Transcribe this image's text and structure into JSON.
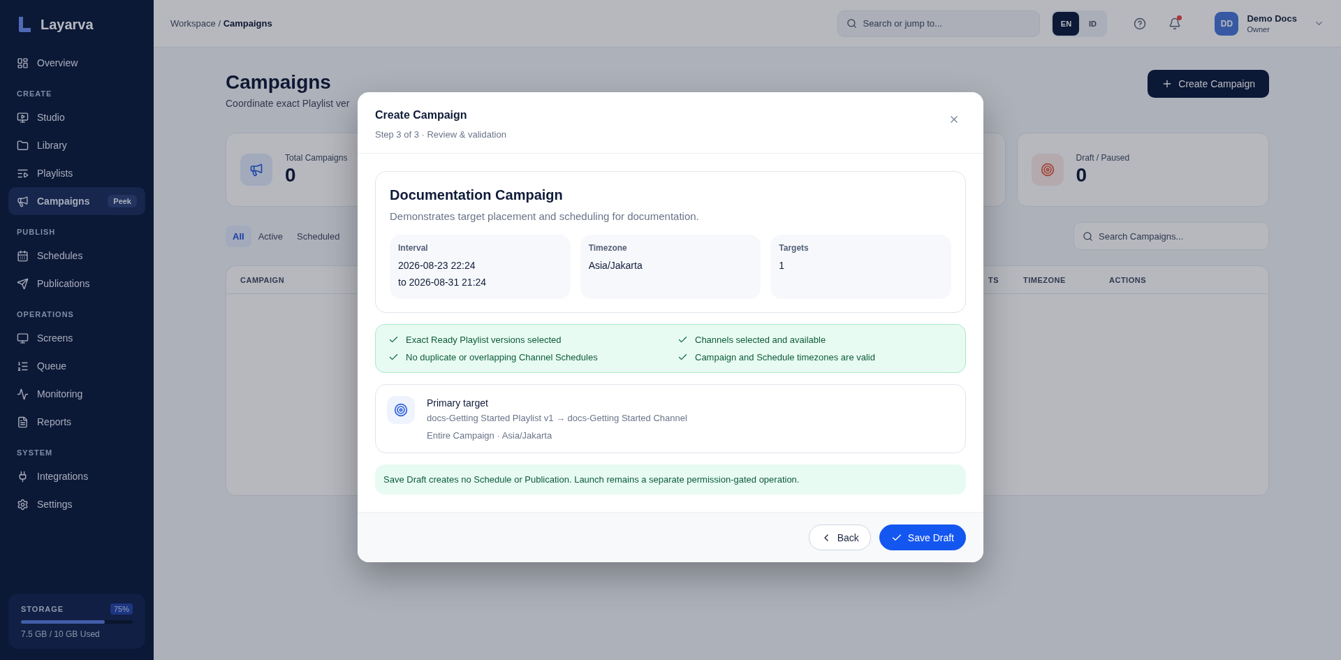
{
  "sidebar": {
    "brand": "Layarva",
    "sections": [
      {
        "items": [
          {
            "label": "Overview",
            "selected": false
          }
        ]
      },
      {
        "title": "CREATE",
        "items": [
          {
            "label": "Studio",
            "selected": false
          },
          {
            "label": "Library",
            "selected": false
          },
          {
            "label": "Playlists",
            "selected": false
          },
          {
            "label": "Campaigns",
            "selected": true,
            "badge": "Peek"
          }
        ]
      },
      {
        "title": "PUBLISH",
        "items": [
          {
            "label": "Schedules",
            "selected": false
          },
          {
            "label": "Publications",
            "selected": false
          }
        ]
      },
      {
        "title": "OPERATIONS",
        "items": [
          {
            "label": "Screens",
            "selected": false
          },
          {
            "label": "Queue",
            "selected": false
          },
          {
            "label": "Monitoring",
            "selected": false
          },
          {
            "label": "Reports",
            "selected": false
          }
        ]
      },
      {
        "title": "SYSTEM",
        "items": [
          {
            "label": "Integrations",
            "selected": false
          },
          {
            "label": "Settings",
            "selected": false
          }
        ]
      }
    ],
    "storage": {
      "title": "STORAGE",
      "percent": "75%",
      "level": 0.75,
      "usage": "7.5 GB / 10 GB Used"
    }
  },
  "header": {
    "breadcrumb": "Workspace / **Campaigns**",
    "search": {
      "placeholder": "Search or jump to..."
    },
    "languages": [
      {
        "label": "EN",
        "selected": true
      },
      {
        "label": "ID",
        "selected": false
      }
    ],
    "notifications": {
      "unread": true
    },
    "user": {
      "initials": "DD",
      "name": "Demo Docs",
      "role": "Owner"
    }
  },
  "page": {
    "title": "Campaigns",
    "subtitle": "Coordinate exact Playlist ver",
    "create_button": "Create Campaign",
    "stats": [
      {
        "label": "Total Campaigns",
        "value": "0",
        "kind": "total"
      },
      {
        "label": "Draft / Paused",
        "value": "0",
        "kind": "draft"
      }
    ],
    "filters": [
      {
        "label": "All",
        "selected": true
      },
      {
        "label": "Active",
        "selected": false
      },
      {
        "label": "Scheduled",
        "selected": false
      }
    ],
    "search": {
      "placeholder": "Search Campaigns..."
    },
    "table": {
      "columns": [
        "CAMPAIGN",
        "TS",
        "TIMEZONE",
        "ACTIONS"
      ]
    }
  },
  "dialog": {
    "title": "Create Campaign",
    "subtitle": "Step 3 of 3 · Review & validation",
    "summary": {
      "name": "Documentation Campaign",
      "description": "Demonstrates target placement and scheduling for documentation.",
      "fields": [
        {
          "label": "Interval",
          "lines": [
            "2026-08-23 22:24",
            "to 2026-08-31 21:24"
          ]
        },
        {
          "label": "Timezone",
          "lines": [
            "Asia/Jakarta"
          ]
        },
        {
          "label": "Targets",
          "lines": [
            "1"
          ]
        }
      ]
    },
    "checks": [
      {
        "label": "Exact Ready Playlist versions selected",
        "passed": true
      },
      {
        "label": "Channels selected and available",
        "passed": true
      },
      {
        "label": "No duplicate or overlapping Channel Schedules",
        "passed": true
      },
      {
        "label": "Campaign and Schedule timezones are valid",
        "passed": true
      }
    ],
    "target": {
      "title": "Primary target",
      "route": "docs-Getting Started Playlist v1 → docs-Getting Started Channel",
      "details": "Entire Campaign · Asia/Jakarta"
    },
    "notice": "Save Draft creates no Schedule or Publication. Launch remains a separate permission-gated operation.",
    "buttons": [
      {
        "label": "Back",
        "kind": "back"
      },
      {
        "label": "Save Draft",
        "kind": "primary"
      }
    ]
  }
}
